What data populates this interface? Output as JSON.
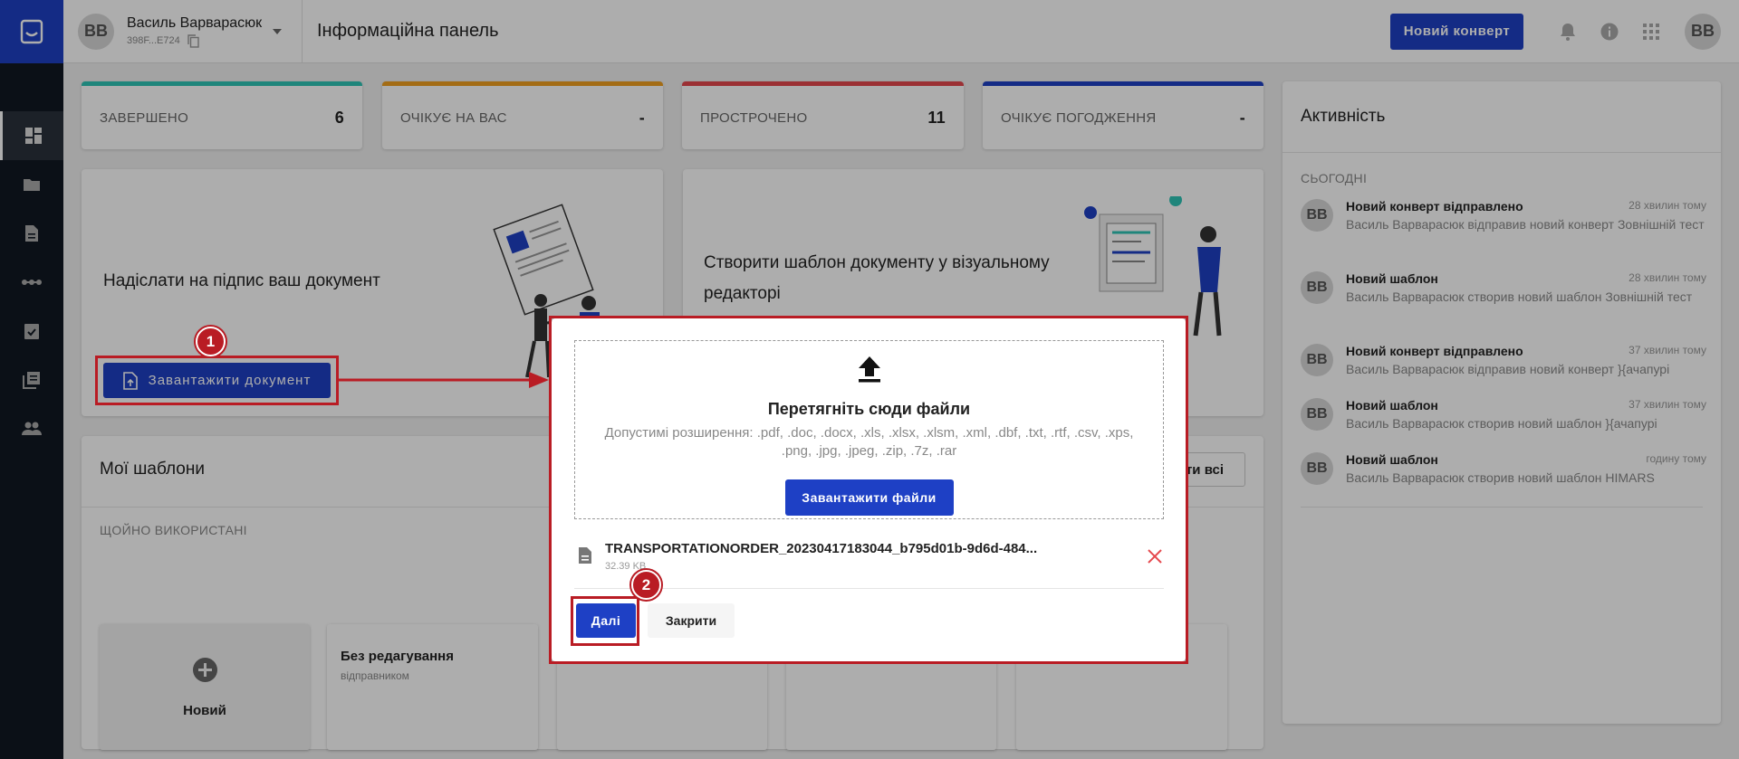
{
  "sidebar": {
    "items": [
      "dashboard-icon",
      "folder-icon",
      "document-icon",
      "dots-icon",
      "checklist-icon",
      "library-icon",
      "people-icon"
    ]
  },
  "topbar": {
    "user_name": "Василь Варварасюк",
    "user_id": "398F...E724",
    "avatar": "ВВ",
    "page_title": "Інформаційна панель",
    "new_envelope": "Новий конверт"
  },
  "stats": [
    {
      "label": "ЗАВЕРШЕНО",
      "value": "6",
      "color": "#2ec4b6"
    },
    {
      "label": "ОЧІКУЄ НА ВАС",
      "value": "-",
      "color": "#f0a020"
    },
    {
      "label": "ПРОСТРОЧЕНО",
      "value": "11",
      "color": "#e5484d"
    },
    {
      "label": "ОЧІКУЄ ПОГОДЖЕННЯ",
      "value": "-",
      "color": "#1e40c5"
    }
  ],
  "send_card": {
    "title": "Надіслати на підпис ваш документ",
    "button": "Завантажити документ"
  },
  "template_card": {
    "title": "Створити шаблон документу у візуальному редакторі"
  },
  "my_templates": {
    "title": "Мої шаблони",
    "view_all": "ти всі",
    "section": "ЩОЙНО ВИКОРИСТАНІ",
    "new_label": "Новий",
    "tile2_title": "Без редагування",
    "tile2_sub": "відправником"
  },
  "activity": {
    "title": "Активність",
    "section": "СЬОГОДНІ",
    "items": [
      {
        "avatar": "ВВ",
        "title": "Новий конверт відправлено",
        "time": "28 хвилин тому",
        "desc": "Василь Варварасюк відправив новий конверт Зовнішній тест"
      },
      {
        "avatar": "ВВ",
        "title": "Новий шаблон",
        "time": "28 хвилин тому",
        "desc": "Василь Варварасюк створив новий шаблон Зовнішній тест"
      },
      {
        "avatar": "ВВ",
        "title": "Новий конверт відправлено",
        "time": "37 хвилин тому",
        "desc": "Василь Варварасюк відправив новий конверт }{ачапурі"
      },
      {
        "avatar": "ВВ",
        "title": "Новий шаблон",
        "time": "37 хвилин тому",
        "desc": "Василь Варварасюк створив новий шаблон }{ачапурі"
      },
      {
        "avatar": "ВВ",
        "title": "Новий шаблон",
        "time": "годину тому",
        "desc": "Василь Варварасюк створив новий шаблон HIMARS"
      }
    ]
  },
  "dialog": {
    "drop_title": "Перетягніть сюди файли",
    "extensions": "Допустимі розширення: .pdf, .doc, .docx, .xls, .xlsx, .xlsm, .xml, .dbf, .txt, .rtf, .csv, .xps, .png, .jpg, .jpeg, .zip, .7z, .rar",
    "upload_button": "Завантажити файли",
    "file_name": "TRANSPORTATIONORDER_20230417183044_b795d01b-9d6d-484...",
    "file_size": "32.39 KB",
    "next": "Далі",
    "close": "Закрити"
  },
  "annotations": {
    "marker1": "1",
    "marker2": "2"
  },
  "colors": {
    "primary": "#1e40c5",
    "annotation": "#b91c24",
    "sidebar": "#111822"
  }
}
